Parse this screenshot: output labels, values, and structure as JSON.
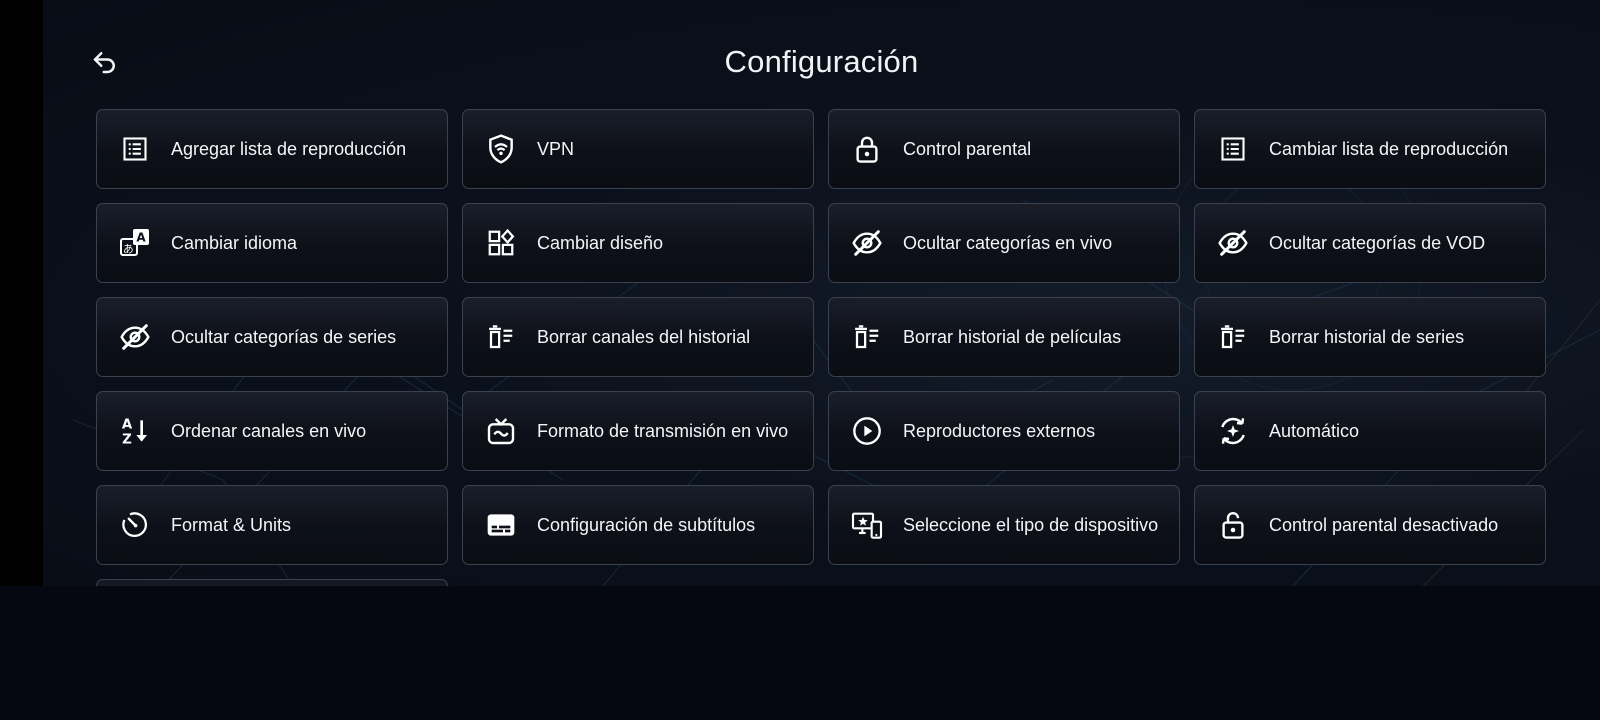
{
  "header": {
    "title": "Configuración",
    "back_icon": "back-arrow-icon"
  },
  "colors": {
    "background": "#0b111c",
    "tile_border": "#3b4150",
    "text": "#f4f5f7"
  },
  "tiles": [
    {
      "label": "Agregar lista de reproducción",
      "icon": "list-icon"
    },
    {
      "label": "VPN",
      "icon": "shield-wifi-icon"
    },
    {
      "label": "Control parental",
      "icon": "lock-icon"
    },
    {
      "label": "Cambiar lista de reproducción",
      "icon": "list-icon"
    },
    {
      "label": "Cambiar idioma",
      "icon": "translate-icon"
    },
    {
      "label": "Cambiar diseño",
      "icon": "layout-icon"
    },
    {
      "label": "Ocultar categorías en vivo",
      "icon": "eye-off-icon"
    },
    {
      "label": "Ocultar categorías de VOD",
      "icon": "eye-off-icon"
    },
    {
      "label": "Ocultar categorías de series",
      "icon": "eye-off-icon"
    },
    {
      "label": "Borrar canales del historial",
      "icon": "delete-list-icon"
    },
    {
      "label": "Borrar historial de películas",
      "icon": "delete-list-icon"
    },
    {
      "label": "Borrar historial de series",
      "icon": "delete-list-icon"
    },
    {
      "label": "Ordenar canales en vivo",
      "icon": "sort-az-icon"
    },
    {
      "label": "Formato de transmisión en vivo",
      "icon": "live-tv-icon"
    },
    {
      "label": "Reproductores externos",
      "icon": "play-circle-icon"
    },
    {
      "label": "Automático",
      "icon": "auto-refresh-icon"
    },
    {
      "label": "Format & Units",
      "icon": "timer-icon"
    },
    {
      "label": "Configuración de subtítulos",
      "icon": "subtitles-icon"
    },
    {
      "label": "Seleccione el tipo de dispositivo",
      "icon": "devices-icon"
    },
    {
      "label": "Control parental desactivado",
      "icon": "unlock-icon"
    }
  ]
}
